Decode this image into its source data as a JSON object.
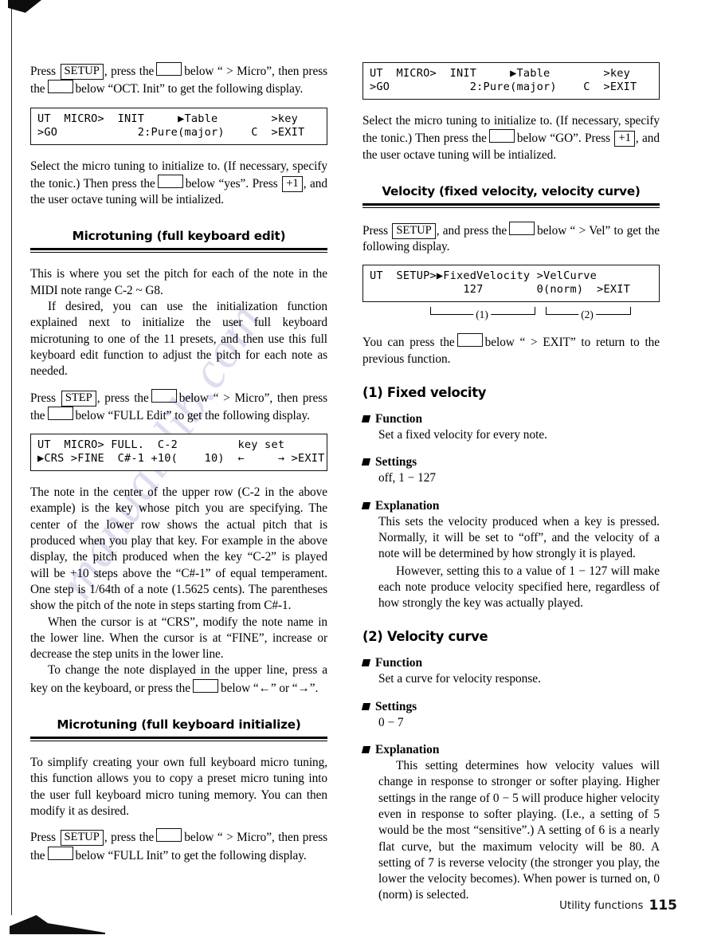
{
  "page": {
    "footer_label": "Utility functions",
    "footer_page_number": "115"
  },
  "watermark": {
    "text": "manualslib.com"
  },
  "left_column": {
    "p1_a": "Press",
    "p1_key": "SETUP",
    "p1_b": ", press the",
    "p1_c": "below “ > Micro”, then press the",
    "p1_d": "below “OCT. Init” to get the following display.",
    "lcd1": {
      "line1": "UT  MICRO>  INIT     ▶Table        >key",
      "line2": ">GO            2:Pure(major)    C  >EXIT"
    },
    "p2_a": "Select the micro tuning to initialize to. (If necessary, specify the tonic.)  Then press the",
    "p2_b": "below “yes”. Press",
    "p2_key": "+1",
    "p2_c": ", and the user octave tuning will be intialized.",
    "heading1": "Microtuning (full keyboard edit)",
    "p3": "This is where you set the pitch for each of the note in the MIDI note range C-2 ~ G8.",
    "p4": "If desired, you can use the initialization function explained next to initialize the user full keyboard microtuning to one of the 11 presets, and then use this full keyboard edit function to adjust the pitch for each note as needed.",
    "p5_a": "Press",
    "p5_key": "STEP",
    "p5_b": ", press the",
    "p5_c": "below “ > Micro”, then press the",
    "p5_d": "below “FULL Edit” to get the following display.",
    "lcd2": {
      "line1": "UT  MICRO> FULL.  C-2         key set",
      "line2": "▶CRS >FINE  C#-1 +10(    10)  ←     → >EXIT"
    },
    "p6": "The note in the center of the upper row (C-2 in the above example) is the key whose pitch you are specifying. The center of the lower row shows the actual pitch that is produced when you play that key. For example in the above display, the pitch produced when the key “C-2” is played will be  +10 steps above the “C#-1” of equal temperament. One step is 1/64th of a note (1.5625 cents). The parentheses show the pitch of the note in steps starting from C#-1.",
    "p7": "When the cursor is at “CRS”, modify the note name in the lower line. When the cursor is at “FINE”, increase or decrease the step units in the lower line.",
    "p8_a": "To change the note displayed in the upper line, press a key on the keyboard, or press the",
    "p8_b": "below “←” or “→”.",
    "heading2": "Microtuning (full keyboard initialize)",
    "p9": "To simplify creating your own full keyboard micro tuning, this function allows you to copy a preset micro tuning into the user full keyboard micro tuning memory. You can then modify it as desired.",
    "p10_a": "Press",
    "p10_key": "SETUP",
    "p10_b": ", press the",
    "p10_c": "below “ > Micro”, then press the",
    "p10_d": "below “FULL Init” to get the following display."
  },
  "right_column": {
    "lcd3": {
      "line1": "UT  MICRO>  INIT     ▶Table        >key",
      "line2": ">GO            2:Pure(major)    C  >EXIT"
    },
    "p1_a": "Select the micro tuning to initialize to. (If necessary, specify the tonic.)  Then press the",
    "p1_b": "below “GO”. Press",
    "p1_key": "+1",
    "p1_c": ", and the user octave tuning will be intialized.",
    "heading1": "Velocity (fixed velocity, velocity curve)",
    "p2_a": "Press",
    "p2_key": "SETUP",
    "p2_b": ", and press the",
    "p2_c": "below “ > Vel” to get the following display.",
    "lcd4": {
      "line1": "UT  SETUP>▶FixedVelocity >VelCurve",
      "line2": "              127        0(norm)  >EXIT"
    },
    "bracket1_label": "(1)",
    "bracket2_label": "(2)",
    "p3_a": "You can press the",
    "p3_b": "below “ > EXIT” to return to the previous function.",
    "sub1_title": "(1) Fixed velocity",
    "sub1_function_head": "Function",
    "sub1_function_body": "Set a fixed velocity for every note.",
    "sub1_settings_head": "Settings",
    "sub1_settings_body": "off, 1 − 127",
    "sub1_explanation_head": "Explanation",
    "sub1_explanation_p1": "This sets the velocity produced when a key is pressed. Normally, it will be set to “off”, and the velocity of a note will be determined by how strongly it is played.",
    "sub1_explanation_p2": "However, setting this to a value of 1 − 127 will make each note produce velocity specified here, regardless of how strongly the key was actually played.",
    "sub2_title": "(2) Velocity curve",
    "sub2_function_head": "Function",
    "sub2_function_body": "Set a curve for velocity response.",
    "sub2_settings_head": "Settings",
    "sub2_settings_body": "0 − 7",
    "sub2_explanation_head": "Explanation",
    "sub2_explanation_p1": "This setting determines how velocity values will change in response to stronger or softer playing. Higher settings in the range of 0 − 5 will produce higher velocity even in response to softer playing. (I.e., a setting of 5 would be the most “sensitive”.) A setting of 6 is a nearly flat curve, but the maximum velocity will be 80. A setting of 7 is reverse velocity (the stronger you play, the lower the velocity becomes). When power is turned on, 0 (norm) is selected."
  }
}
